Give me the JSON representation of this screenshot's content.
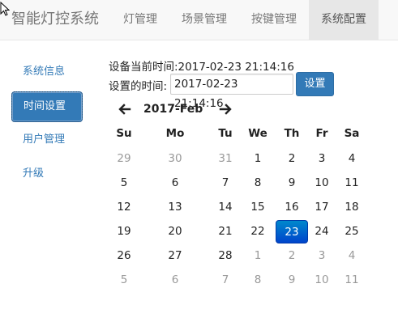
{
  "app": {
    "brand": "智能灯控系统"
  },
  "nav": {
    "tabs": [
      {
        "label": "灯管理"
      },
      {
        "label": "场景管理"
      },
      {
        "label": "按键管理"
      },
      {
        "label": "系统配置",
        "active": true
      }
    ]
  },
  "sidebar": {
    "items": [
      {
        "label": "系统信息"
      },
      {
        "label": "时间设置",
        "active": true
      },
      {
        "label": "用户管理"
      },
      {
        "label": "升级"
      }
    ]
  },
  "time_settings": {
    "current_time_label": "设备当前时间:2017-02-23 21:14:16",
    "set_time_label": "设置的时间:",
    "set_time_value": "2017-02-23 21:14:16",
    "set_button_label": "设置"
  },
  "calendar": {
    "title": "2017-Feb",
    "weekdays": [
      "Su",
      "Mo",
      "Tu",
      "We",
      "Th",
      "Fr",
      "Sa"
    ],
    "selected_day": "23",
    "weeks": [
      [
        {
          "d": "29",
          "m": true
        },
        {
          "d": "30",
          "m": true
        },
        {
          "d": "31",
          "m": true
        },
        {
          "d": "1"
        },
        {
          "d": "2"
        },
        {
          "d": "3"
        },
        {
          "d": "4"
        }
      ],
      [
        {
          "d": "5"
        },
        {
          "d": "6"
        },
        {
          "d": "7"
        },
        {
          "d": "8"
        },
        {
          "d": "9"
        },
        {
          "d": "10"
        },
        {
          "d": "11"
        }
      ],
      [
        {
          "d": "12"
        },
        {
          "d": "13"
        },
        {
          "d": "14"
        },
        {
          "d": "15"
        },
        {
          "d": "16"
        },
        {
          "d": "17"
        },
        {
          "d": "18"
        }
      ],
      [
        {
          "d": "19"
        },
        {
          "d": "20"
        },
        {
          "d": "21"
        },
        {
          "d": "22"
        },
        {
          "d": "23",
          "s": true
        },
        {
          "d": "24"
        },
        {
          "d": "25"
        }
      ],
      [
        {
          "d": "26"
        },
        {
          "d": "27"
        },
        {
          "d": "28"
        },
        {
          "d": "1",
          "m": true
        },
        {
          "d": "2",
          "m": true
        },
        {
          "d": "3",
          "m": true
        },
        {
          "d": "4",
          "m": true
        }
      ],
      [
        {
          "d": "5",
          "m": true
        },
        {
          "d": "6",
          "m": true
        },
        {
          "d": "7",
          "m": true
        },
        {
          "d": "8",
          "m": true
        },
        {
          "d": "9",
          "m": true
        },
        {
          "d": "10",
          "m": true
        },
        {
          "d": "11",
          "m": true
        }
      ]
    ],
    "colors": {
      "selected_bg": "#0055cc",
      "muted": "#999999"
    }
  },
  "colors": {
    "accent": "#337ab7",
    "navbar_bg": "#f8f8f8"
  },
  "icons": {
    "cursor": "mouse-pointer-icon",
    "prev": "arrow-left-icon",
    "next": "arrow-right-icon"
  }
}
